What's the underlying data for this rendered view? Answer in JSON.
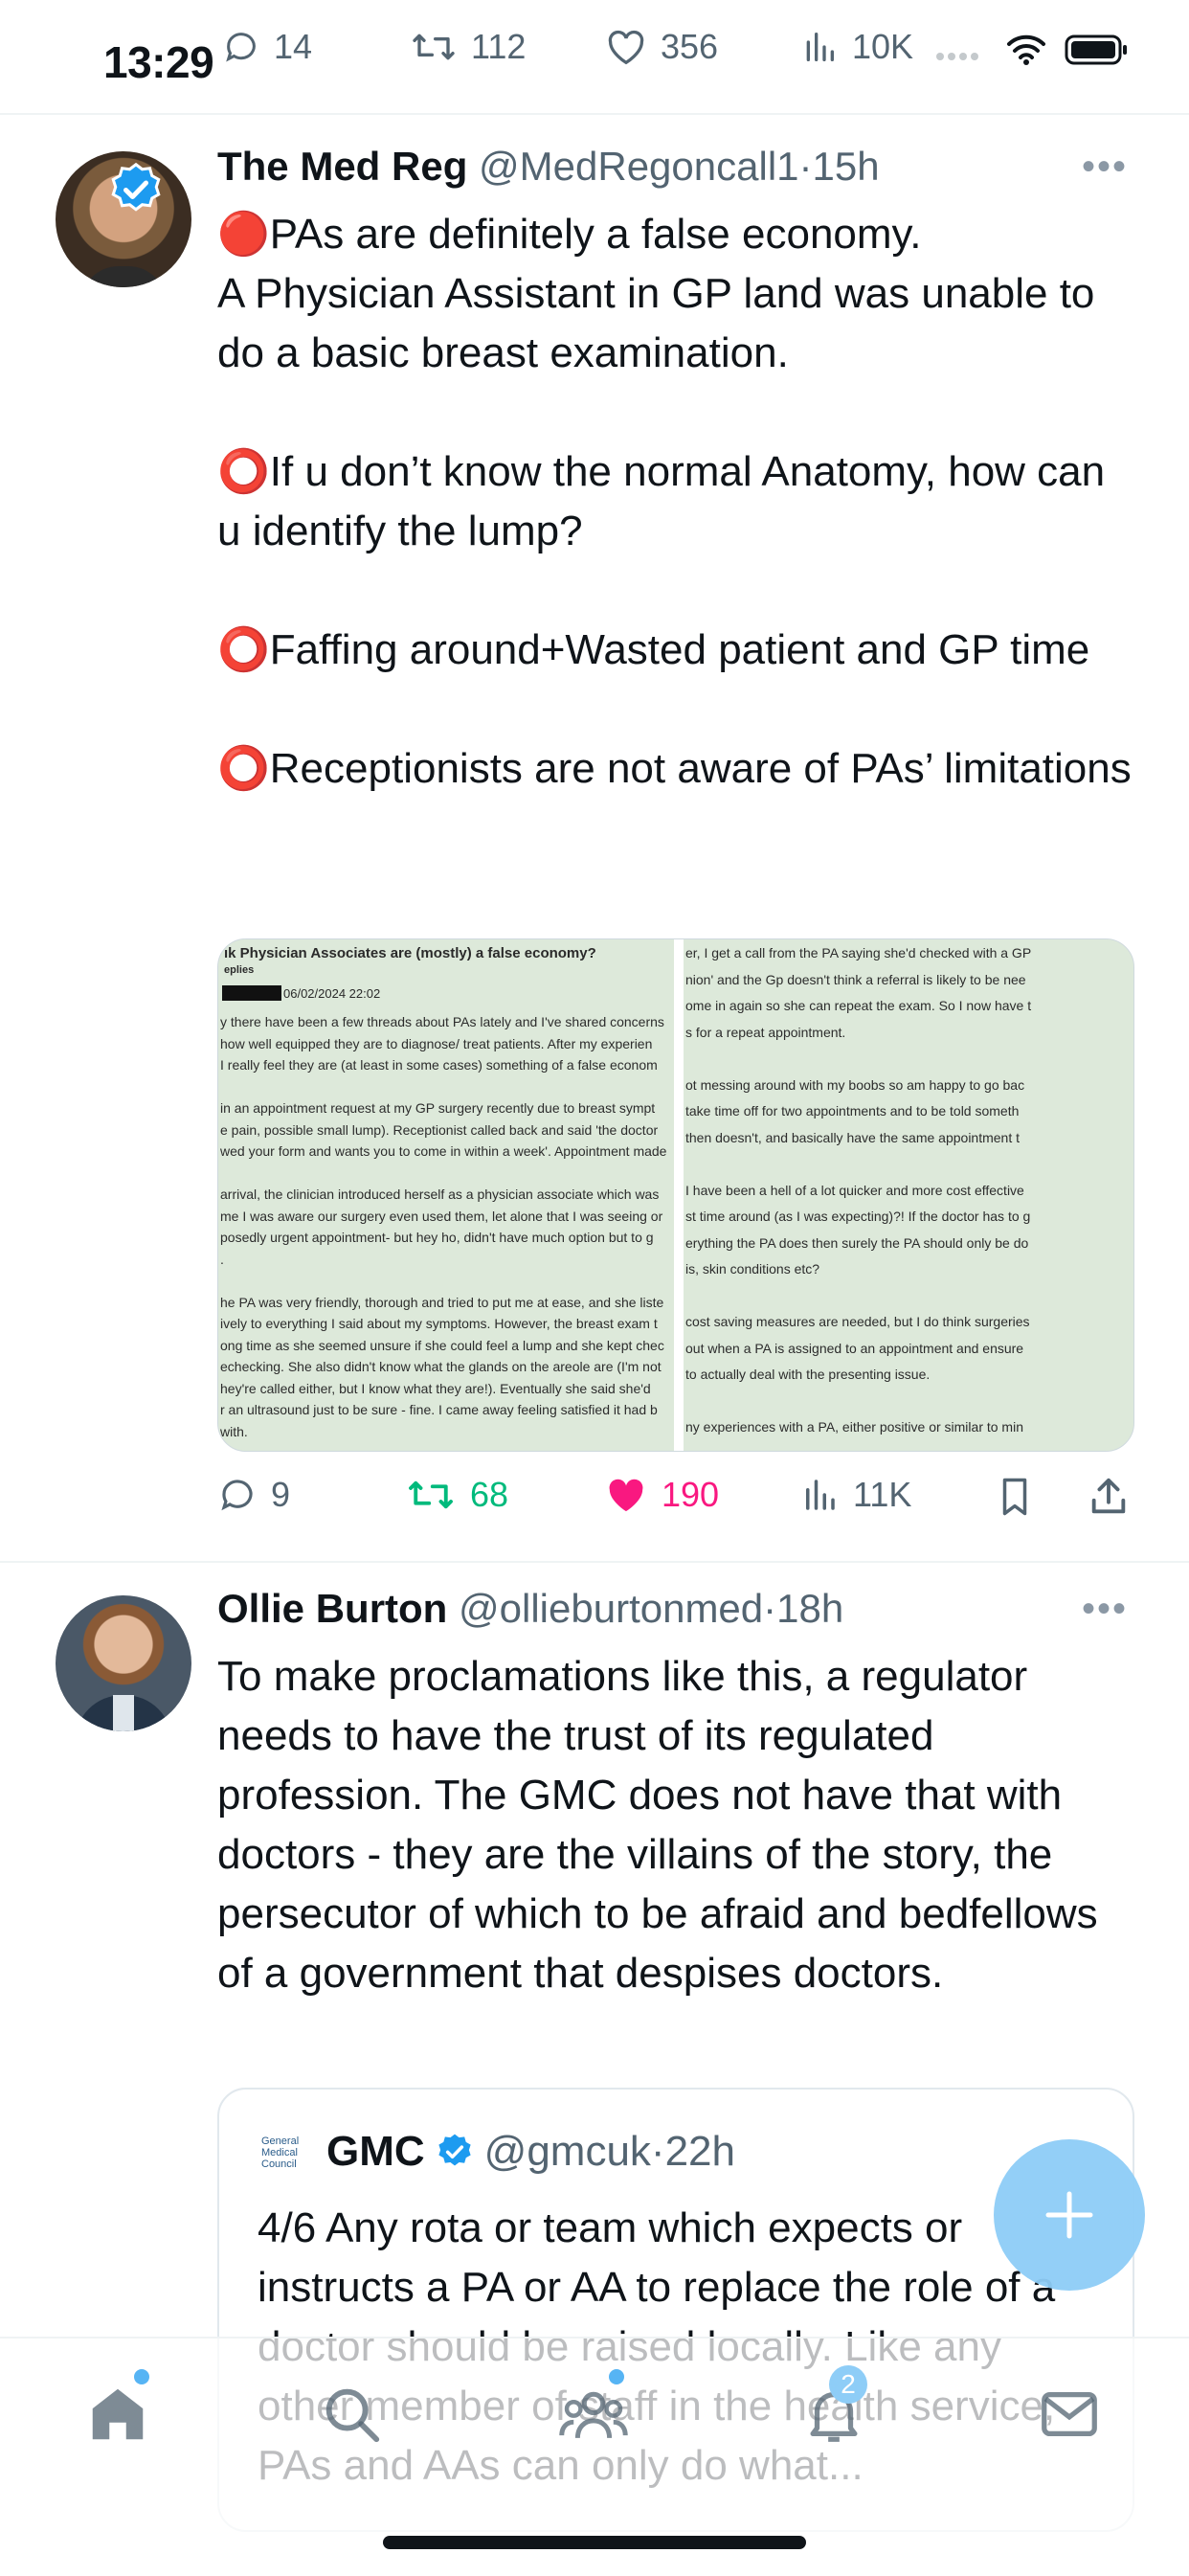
{
  "status_bar": {
    "time": "13:29"
  },
  "previous_tweet_actions": {
    "replies": "14",
    "retweets": "112",
    "likes": "356",
    "views": "10K"
  },
  "tweets": [
    {
      "display_name": "The Med Reg",
      "handle": "@MedRegoncall1",
      "separator": "·",
      "time": "15h",
      "verified": true,
      "paragraphs": [
        "🔴PAs are definitely a false economy.",
        "A Physician Assistant in GP land was unable to do a basic breast examination.",
        "⭕If u don’t know the normal Anatomy, how can u identify the lump?",
        "⭕Faffing around+Wasted patient and GP time",
        "⭕Receptionists are not aware of PAs’ limitations"
      ],
      "media": {
        "left_title": "ık Physician Associates are (mostly) a false economy?",
        "left_meta": "eplies",
        "left_date": "06/02/2024 22:02",
        "left_lines": [
          "y there have been a few threads about PAs lately and I've shared concerns",
          " how well equipped they are to diagnose/ treat patients. After my experien",
          " I really feel they are (at least in some cases) something of a false econom",
          "",
          "in an appointment request at my GP surgery recently due to breast sympt",
          "e pain, possible small lump). Receptionist called back and said 'the doctor",
          "wed your form and wants you to come in within a week'. Appointment made",
          "",
          "arrival, the clinician introduced herself as a physician associate which was",
          "me I was aware our surgery even used them, let alone that I was seeing or",
          "posedly urgent appointment- but hey ho, didn't have much option but to g",
          ".",
          "",
          "he PA was very friendly, thorough and tried to put me at ease, and she liste",
          "ively to everything I said about my symptoms. However, the breast exam t",
          "ong time as she seemed unsure if she could feel a lump and she kept chec",
          "echecking. She also didn't know what the glands on the areole are (I'm not",
          "hey're called either, but I know what they are!). Eventually she said she'd",
          "r an ultrasound just to be sure - fine. I came away feeling satisfied it had b",
          "with."
        ],
        "right_lines": [
          "er, I get a call from the PA saying she'd checked with a GP",
          "nion' and the Gp doesn't think a referral is likely to be nee",
          "ome in again so she can repeat the exam. So I now have t",
          "s for a repeat appointment.",
          "",
          "ot messing around with my boobs so am happy to go bac",
          "take time off for two appointments and to be told someth",
          " then doesn't, and basically have the same appointment t",
          "",
          "I have been a hell of a lot quicker and more cost effective",
          "st time around (as I was expecting)?! If the doctor has to g",
          "erything the PA does then surely the PA should only be do",
          "is, skin conditions etc?",
          "",
          "cost saving measures are needed, but I do think surgeries",
          "out when a PA is assigned to an appointment and ensure",
          " to actually deal with the presenting issue.",
          "",
          "ny experiences with a PA, either positive or similar to min"
        ]
      },
      "actions": {
        "replies": "9",
        "retweets": "68",
        "likes": "190",
        "views": "11K"
      }
    },
    {
      "display_name": "Ollie Burton",
      "handle": "@ollieburtonmed",
      "separator": "·",
      "time": "18h",
      "verified": false,
      "text": "To make proclamations like this, a regulator needs to have the trust of its regulated profession. The GMC does not have that with doctors - they are the villains of the story, the persecutor of which to be afraid and bedfellows of a government that despises doctors.",
      "quote": {
        "logo_lines": [
          "General",
          "Medical",
          "Council"
        ],
        "display_name": "GMC",
        "handle": "@gmcuk",
        "separator": "·",
        "time": "22h",
        "verified": true,
        "text": "4/6 Any rota or team which expects or instructs a PA or AA to replace the role of a doctor should be raised locally. Like any other member of staff in the health service, PAs and AAs can only do what..."
      }
    }
  ],
  "bottom_nav": {
    "items": [
      {
        "name": "home",
        "icon": "home-icon",
        "has_dot": true
      },
      {
        "name": "search",
        "icon": "search-icon"
      },
      {
        "name": "communities",
        "icon": "communities-icon",
        "has_dot": true
      },
      {
        "name": "notifications",
        "icon": "bell-icon",
        "badge": "2"
      },
      {
        "name": "messages",
        "icon": "mail-icon"
      }
    ]
  },
  "colors": {
    "text": "#0f1419",
    "secondary": "#536471",
    "accent": "#1d9bf0",
    "retweet_green": "#00ba7c",
    "like_pink": "#f91880",
    "fab": "#8ecdf7"
  }
}
